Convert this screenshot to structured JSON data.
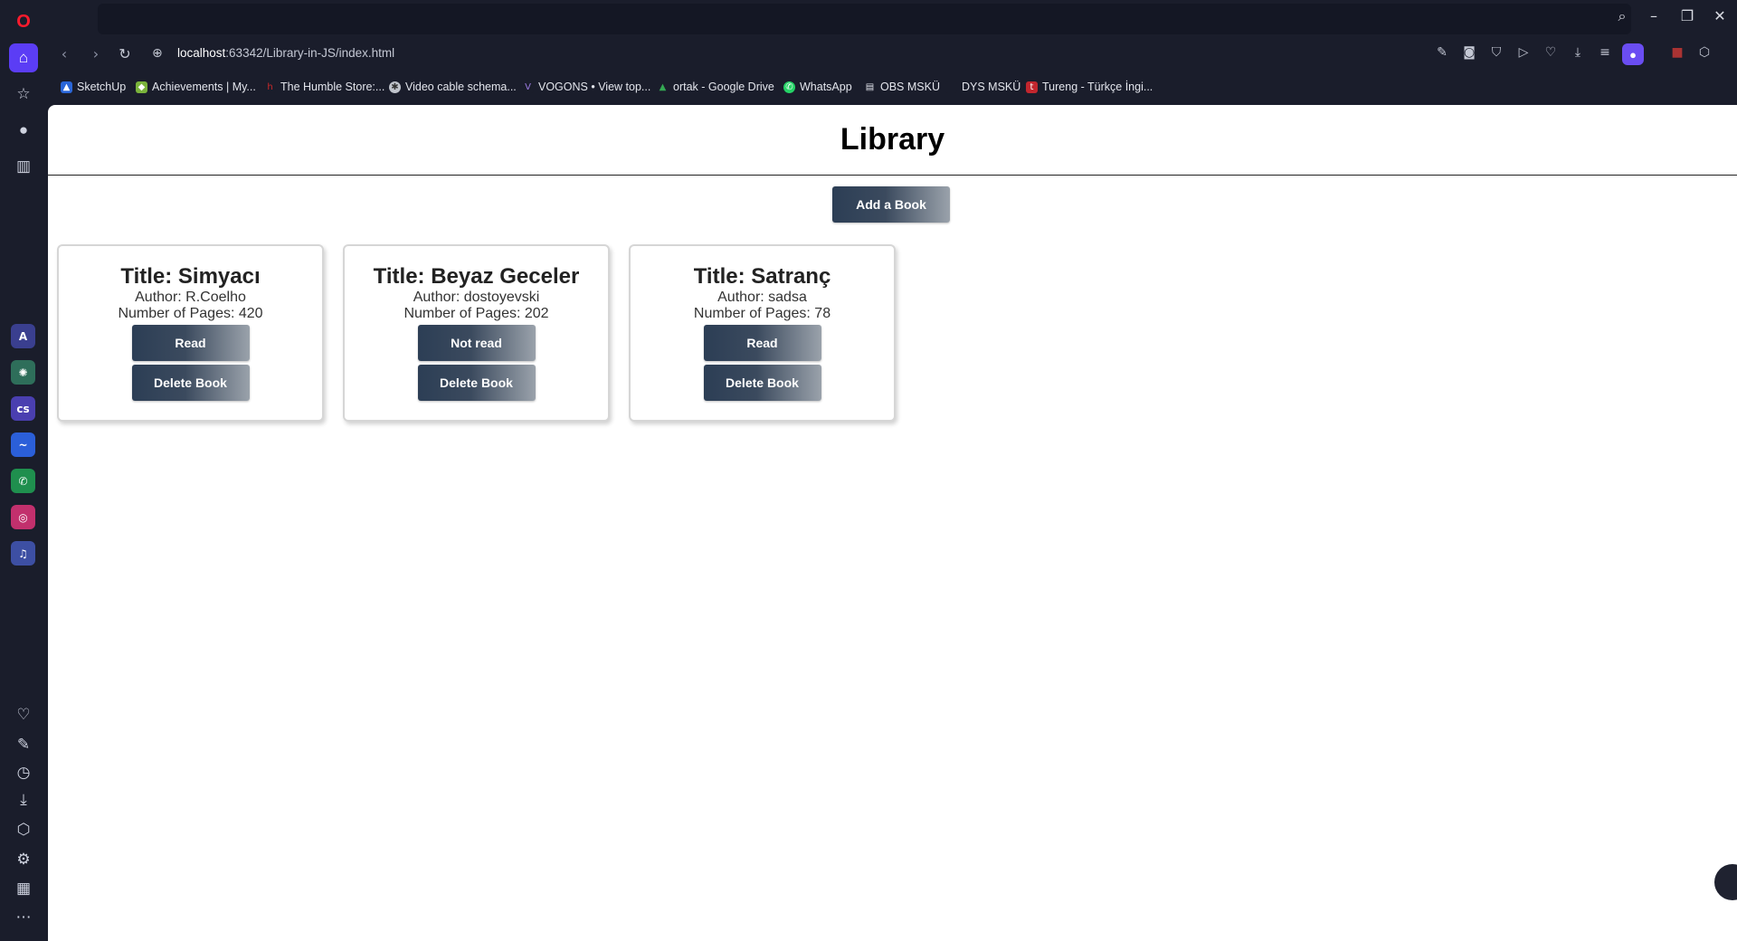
{
  "browser": {
    "address": {
      "host": "localhost",
      "path": ":63342/Library-in-JS/index.html"
    },
    "bookmarks": [
      {
        "label": "SketchUp",
        "icon": "sketchup-icon",
        "color": "#2a66d8"
      },
      {
        "label": "Achievements | My...",
        "icon": "steam-achievement-icon",
        "color": "#7ab33b"
      },
      {
        "label": "The Humble Store:...",
        "icon": "humble-icon",
        "color": "#cc2929"
      },
      {
        "label": "Video cable schema...",
        "icon": "cable-icon",
        "color": "#c0c4cc"
      },
      {
        "label": "VOGONS • View top...",
        "icon": "vogons-icon",
        "color": "#7a5ac8"
      },
      {
        "label": "ortak - Google Drive",
        "icon": "google-drive-icon",
        "color": "#34a853"
      },
      {
        "label": "WhatsApp",
        "icon": "whatsapp-icon",
        "color": "#25d366"
      },
      {
        "label": "OBS MSKÜ",
        "icon": "document-icon",
        "color": "#e3e5ec"
      },
      {
        "label": "DYS MSKÜ",
        "icon": "dys-icon",
        "color": "#1a1d2b"
      },
      {
        "label": "Tureng - Türkçe İngi...",
        "icon": "tureng-icon",
        "color": "#c2262e"
      }
    ]
  },
  "page": {
    "heading": "Library",
    "add_button": "Add a Book",
    "books": [
      {
        "title": "Title: Simyacı",
        "author": "Author: R.Coelho",
        "pages": "Number of Pages: 420",
        "status": "Read",
        "delete": "Delete Book"
      },
      {
        "title": "Title: Beyaz Geceler",
        "author": "Author: dostoyevski",
        "pages": "Number of Pages: 202",
        "status": "Not read",
        "delete": "Delete Book"
      },
      {
        "title": "Title: Satranç",
        "author": "Author: sadsa",
        "pages": "Number of Pages: 78",
        "status": "Read",
        "delete": "Delete Book"
      }
    ]
  },
  "colors": {
    "browser_bg": "#1a1d2b",
    "button_gradient_start": "#2c3e55",
    "button_gradient_end": "#9aa2ab",
    "accent": "#6a4df2"
  }
}
